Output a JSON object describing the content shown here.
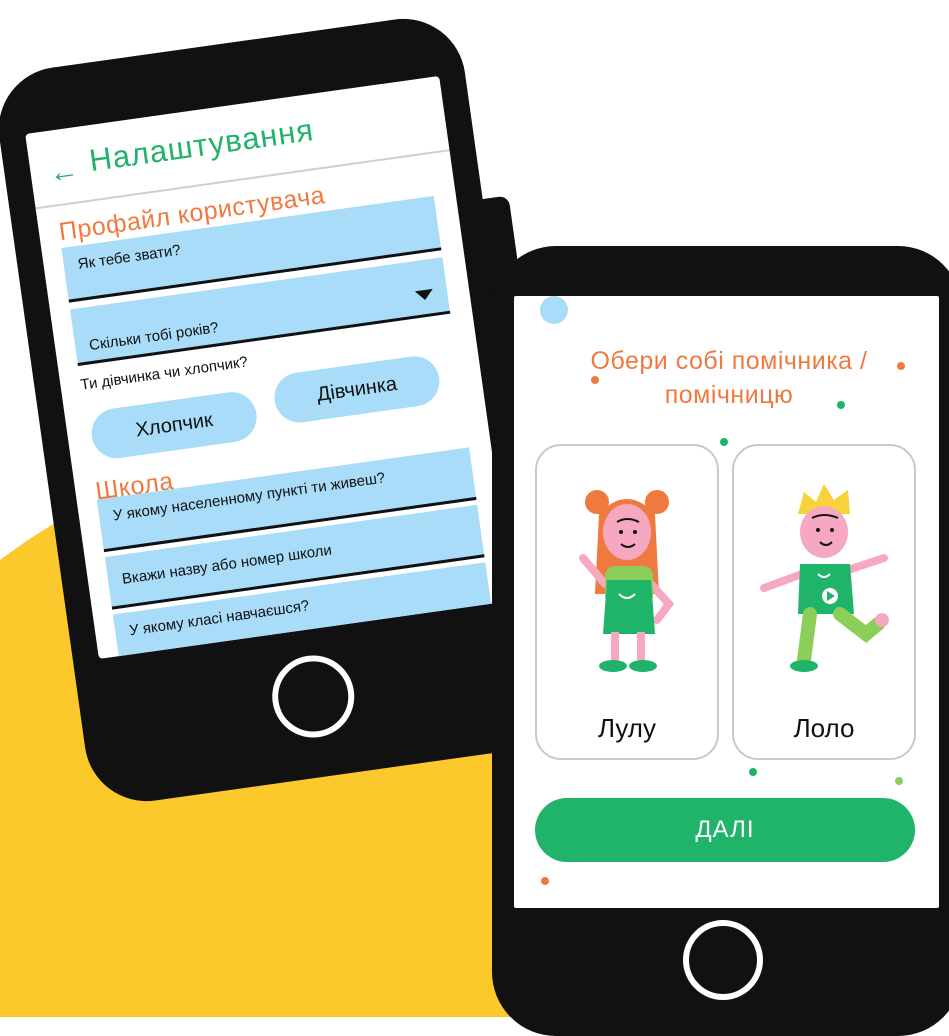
{
  "settings_screen": {
    "title": "Налаштування",
    "profile_section": "Профайл користувача",
    "name_field": "Як тебе звати?",
    "age_field": "Скільки тобі років?",
    "gender_question": "Ти дівчинка чи хлопчик?",
    "boy_button": "Хлопчик",
    "girl_button": "Дівчинка",
    "school_section": "Школа",
    "city_field": "У якому населенному пункті ти живеш?",
    "school_field": "Вкажи назву або номер школи",
    "grade_field": "У якому класі навчаєшся?"
  },
  "helper_screen": {
    "title_line1": "Обери собі помічника /",
    "title_line2": "помічницю",
    "helpers": [
      {
        "name": "Лулу",
        "icon": "girl-character-icon"
      },
      {
        "name": "Лоло",
        "icon": "boy-character-icon"
      }
    ],
    "next_button": "ДАЛІ"
  },
  "colors": {
    "accent_green": "#20b36a",
    "accent_orange": "#ef7a3f",
    "field_blue": "#a8dcf8",
    "background_yellow": "#fcc92c",
    "phone_black": "#111111"
  }
}
